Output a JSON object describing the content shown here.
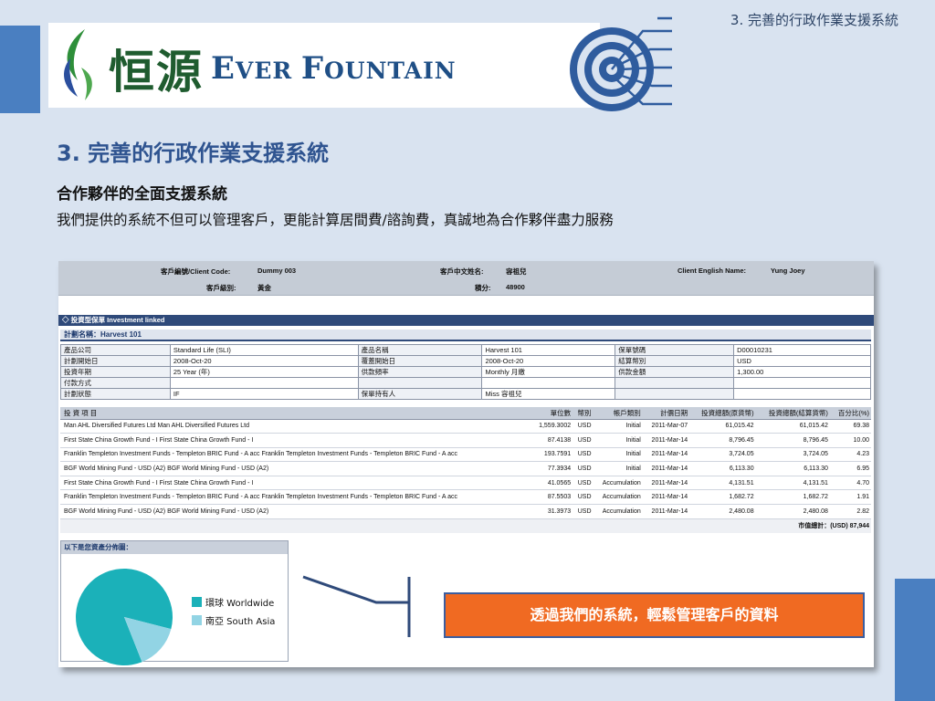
{
  "header": {
    "logo_cn": "恒源",
    "logo_en": {
      "e": "E",
      "ver": "VER ",
      "f": "F",
      "ountain": "OUNTAIN"
    },
    "top_right_title": "3. 完善的行政作業支援系統"
  },
  "page": {
    "title": "3. 完善的行政作業支援系統",
    "sub_heading": "合作夥伴的全面支援系統",
    "description": "我們提供的系統不但可以管理客戶，更能計算居間費/諮詢費，真誠地為合作夥伴盡力服務"
  },
  "client": {
    "code_label": "客戶編號/Client Code:",
    "code_value": "Dummy 003",
    "cn_name_label": "客戶中文姓名:",
    "cn_name_value": "容祖兒",
    "en_name_label": "Client English Name:",
    "en_name_value": "Yung Joey",
    "level_label": "客戶級別:",
    "level_value": "黃金",
    "points_label": "積分:",
    "points_value": "48900"
  },
  "section_title": "◇ 投資型保單 Investment linked",
  "plan_name": "計劃名稱：Harvest 101",
  "plan_info": [
    [
      "產品公司",
      "Standard Life (SLI)",
      "產品名稱",
      "Harvest 101",
      "保單號碼",
      "D00010231"
    ],
    [
      "計劃開始日",
      "2008-Oct-20",
      "覆蓋開始日",
      "2008-Oct-20",
      "結算幣別",
      "USD"
    ],
    [
      "投資年期",
      "25 Year (年)",
      "供款頻率",
      "Monthly 月繳",
      "供款金額",
      "1,300.00"
    ],
    [
      "付款方式",
      "",
      "",
      "",
      "",
      ""
    ],
    [
      "計劃狀態",
      "IF",
      "保單持有人",
      "Miss 容祖兒",
      "",
      ""
    ]
  ],
  "investments": {
    "headers": [
      "投 資 項 目",
      "單位數",
      "幣別",
      "帳戶類別",
      "計價日期",
      "投資總額(原貨幣)",
      "投資總額(結算貨幣)",
      "百分比(%)"
    ],
    "rows": [
      [
        "Man AHL Diversified Futures Ltd Man AHL Diversified Futures Ltd",
        "1,559.3002",
        "USD",
        "Initial",
        "2011-Mar-07",
        "61,015.42",
        "61,015.42",
        "69.38"
      ],
      [
        "First State China Growth Fund - I First State China Growth Fund - I",
        "87.4138",
        "USD",
        "Initial",
        "2011-Mar-14",
        "8,796.45",
        "8,796.45",
        "10.00"
      ],
      [
        "Franklin Templeton Investment Funds - Templeton BRIC Fund - A acc Franklin Templeton Investment Funds - Templeton BRIC Fund - A acc",
        "193.7591",
        "USD",
        "Initial",
        "2011-Mar-14",
        "3,724.05",
        "3,724.05",
        "4.23"
      ],
      [
        "BGF World Mining Fund - USD (A2) BGF World Mining Fund - USD (A2)",
        "77.3934",
        "USD",
        "Initial",
        "2011-Mar-14",
        "6,113.30",
        "6,113.30",
        "6.95"
      ],
      [
        "First State China Growth Fund - I First State China Growth Fund - I",
        "41.0565",
        "USD",
        "Accumulation",
        "2011-Mar-14",
        "4,131.51",
        "4,131.51",
        "4.70"
      ],
      [
        "Franklin Templeton Investment Funds - Templeton BRIC Fund - A acc Franklin Templeton Investment Funds - Templeton BRIC Fund - A acc",
        "87.5503",
        "USD",
        "Accumulation",
        "2011-Mar-14",
        "1,682.72",
        "1,682.72",
        "1.91"
      ],
      [
        "BGF World Mining Fund - USD (A2) BGF World Mining Fund - USD (A2)",
        "31.3973",
        "USD",
        "Accumulation",
        "2011-Mar-14",
        "2,480.08",
        "2,480.08",
        "2.82"
      ]
    ],
    "total": "市值總計：(USD) 87,944"
  },
  "distribution": {
    "title": "以下是您資產分佈圖：",
    "legend": [
      {
        "label": "環球 Worldwide",
        "color": "#1bb1b9"
      },
      {
        "label": "南亞 South Asia",
        "color": "#92d4e4"
      }
    ]
  },
  "chart_data": {
    "type": "pie",
    "title": "以下是您資產分佈圖：",
    "categories": [
      "環球 Worldwide",
      "南亞 South Asia"
    ],
    "values": [
      85,
      15
    ],
    "colors": [
      "#1bb1b9",
      "#92d4e4"
    ]
  },
  "callout": "透過我們的系統，輕鬆管理客戶的資料",
  "colors": {
    "accent_blue": "#4a7fc1",
    "title_blue": "#2f5490",
    "callout_orange": "#f06a22"
  }
}
